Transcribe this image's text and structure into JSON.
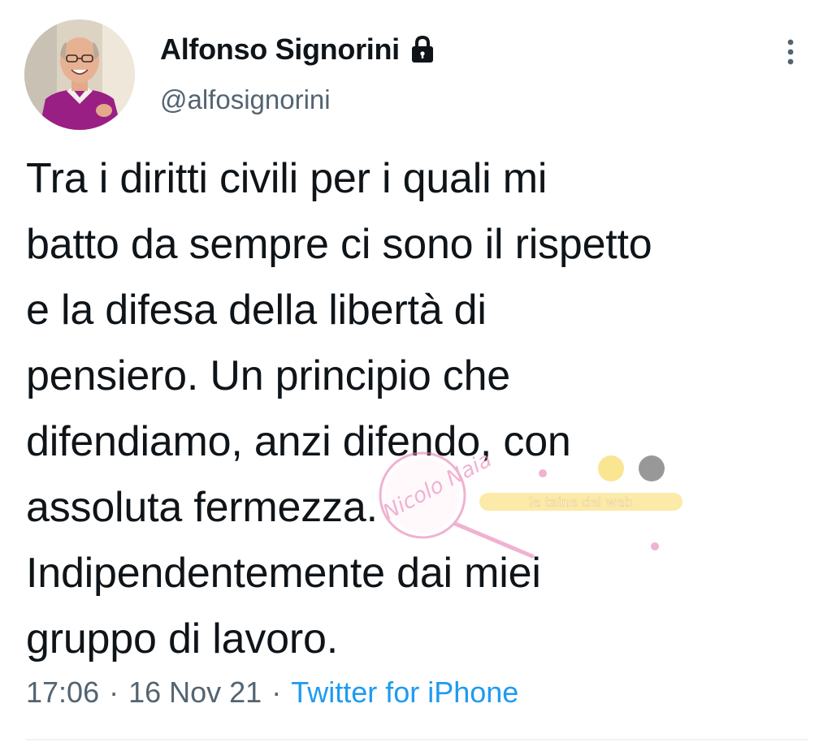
{
  "author": {
    "display_name": "Alfonso Signorini",
    "handle": "@alfosignorini",
    "protected_icon": "lock-icon",
    "avatar_icon": "profile-photo"
  },
  "more_icon": "vertical-ellipsis-icon",
  "tweet": {
    "lines": [
      "Tra i diritti civili per i quali mi",
      "batto da sempre ci sono il rispetto",
      "e la difesa della libertà di",
      "pensiero. Un principio che",
      "difendiamo, anzi difendo, con",
      "assoluta fermezza.",
      "Indipendentemente dai miei",
      "gruppo di lavoro."
    ]
  },
  "meta": {
    "time": "17:06",
    "separator": "·",
    "date": "16 Nov 21",
    "source": "Twitter for iPhone"
  },
  "watermark": {
    "signature": "Nicolo Naia",
    "banner": "le taine del web"
  },
  "colors": {
    "text": "#0f1419",
    "secondary": "#536471",
    "link": "#1d9bf0",
    "divider": "#eff3f4",
    "watermark_pink": "#e77fb3"
  }
}
